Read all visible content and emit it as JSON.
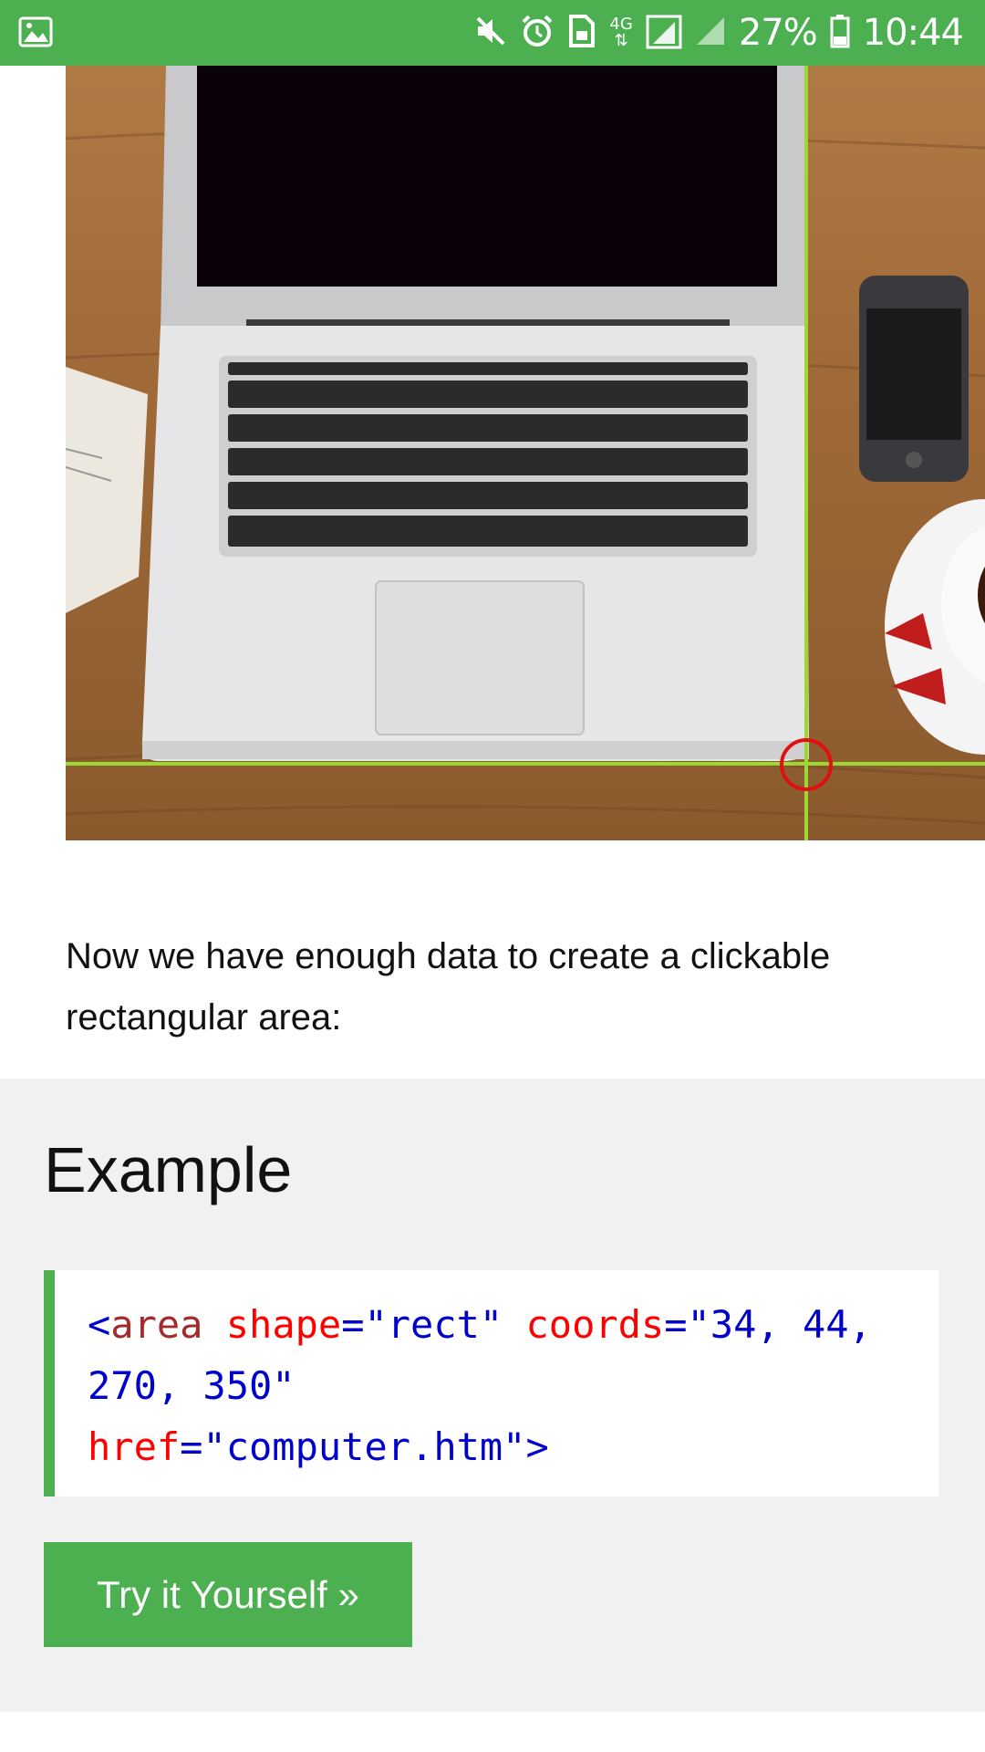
{
  "status_bar": {
    "battery": "27%",
    "time": "10:44",
    "network": "4G"
  },
  "content": {
    "paragraph": "Now we have enough data to create a clickable rectangular area:"
  },
  "example": {
    "title": "Example",
    "code": {
      "open_bracket": "<",
      "tag": "area",
      "attr_shape": "shape",
      "eq1": "=",
      "val_shape": "\"rect\"",
      "attr_coords": "coords",
      "eq2": "=",
      "val_coords": "\"34, 44, 270, 350\"",
      "attr_href": "href",
      "eq3": "=",
      "val_href": "\"computer.htm\"",
      "close_bracket": ">"
    },
    "button_label": "Try it Yourself »"
  },
  "colors": {
    "accent": "#4CAF50",
    "example_bg": "#f1f1f1",
    "code_tag": "#a52a2a",
    "code_attr": "#ff0000",
    "code_value": "#0000cd",
    "guide_line": "#9ad832",
    "marker": "#e01010"
  },
  "icons": {
    "status_left": "image-icon",
    "mute": "mute-icon",
    "alarm": "alarm-icon",
    "sim": "sim-icon",
    "signal": "signal-icon",
    "battery": "battery-icon"
  }
}
